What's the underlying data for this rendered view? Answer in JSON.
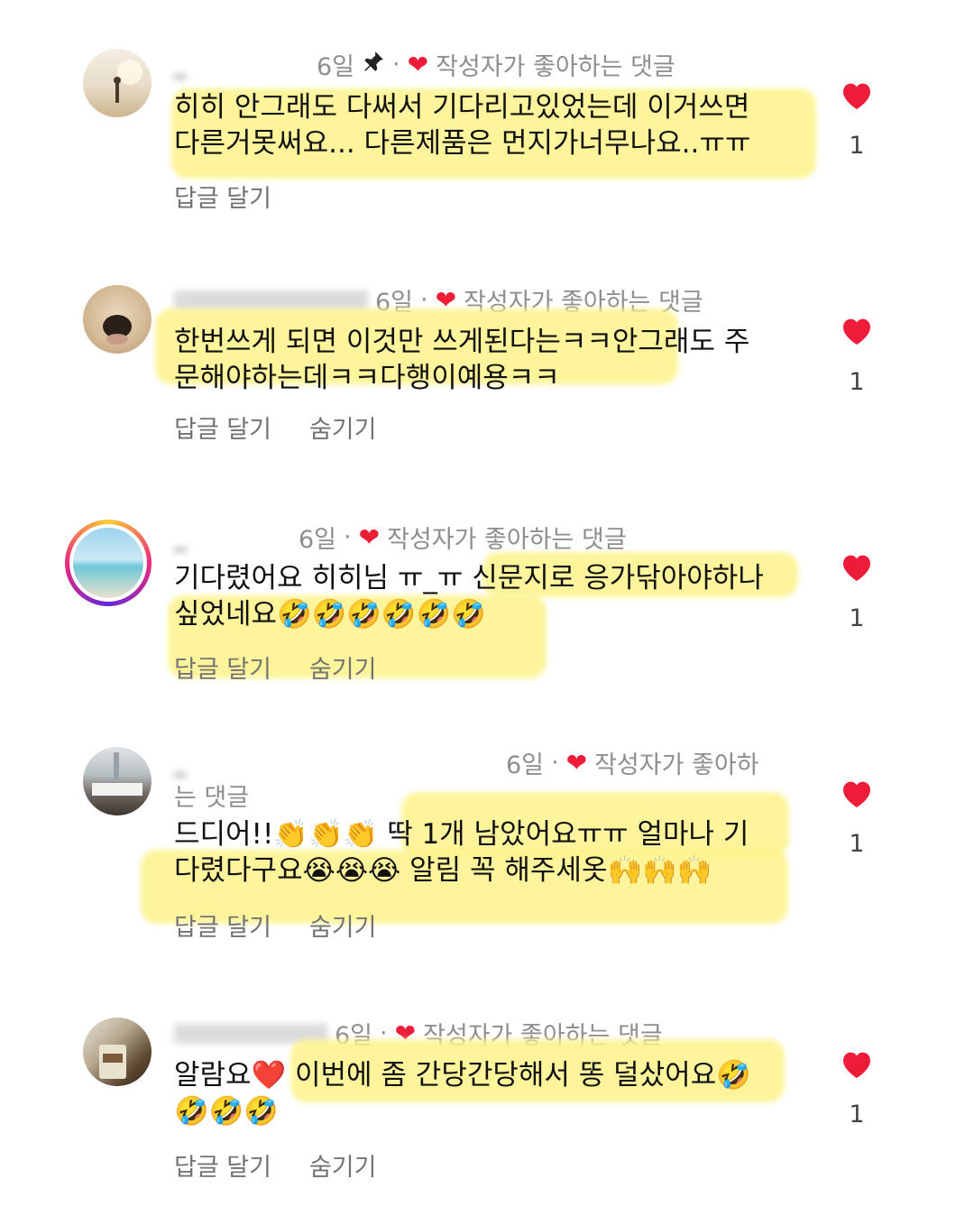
{
  "colors": {
    "like_red": "#ed1d3a",
    "highlight": "#fdf38a",
    "meta_gray": "#8e8e8e"
  },
  "comments": [
    {
      "username": "_",
      "age": "6일",
      "pinned": true,
      "author_liked": "작성자가 좋아하는 댓글",
      "line1": "히히 안그래도 다써서 기다리고있었는데 이거쓰면",
      "line2": "다른거못써요... 다른제품은 먼지가너무나요..ㅠㅠ",
      "reply": "답글 달기",
      "hide": "",
      "likes": "1"
    },
    {
      "username": "",
      "age": "6일",
      "author_liked": "작성자가 좋아하는 댓글",
      "line1": "한번쓰게 되면 이것만 쓰게된다는ㅋㅋ안그래도 주",
      "line2": "문해야하는데ㅋㅋ다행이예용ㅋㅋ",
      "reply": "답글 달기",
      "hide": "숨기기",
      "likes": "1"
    },
    {
      "username": "_",
      "age": "6일",
      "author_liked": "작성자가 좋아하는 댓글",
      "line1": "기다렸어요 히히님 ㅠ_ㅠ 신문지로 응가닦아야하나",
      "line2": "싶었네요🤣🤣🤣🤣🤣🤣",
      "reply": "답글 달기",
      "hide": "숨기기",
      "likes": "1"
    },
    {
      "username": "_",
      "age": "6일",
      "author_liked_a": "작성자가 좋아하",
      "author_liked_b": "는 댓글",
      "line1": "드디어!!👏👏👏 딱 1개 남았어요ㅠㅠ 얼마나 기",
      "line2": "다렸다구요😭😭😭 알림 꼭 해주세옷🙌🙌🙌",
      "reply": "답글 달기",
      "hide": "숨기기",
      "likes": "1"
    },
    {
      "username": "",
      "age": "6일",
      "author_liked": "작성자가 좋아하는 댓글",
      "line1": "알람요❤️ 이번에 좀 간당간당해서 똥 덜샀어요🤣",
      "line2": "🤣🤣🤣",
      "reply": "답글 달기",
      "hide": "숨기기",
      "likes": "1"
    }
  ]
}
